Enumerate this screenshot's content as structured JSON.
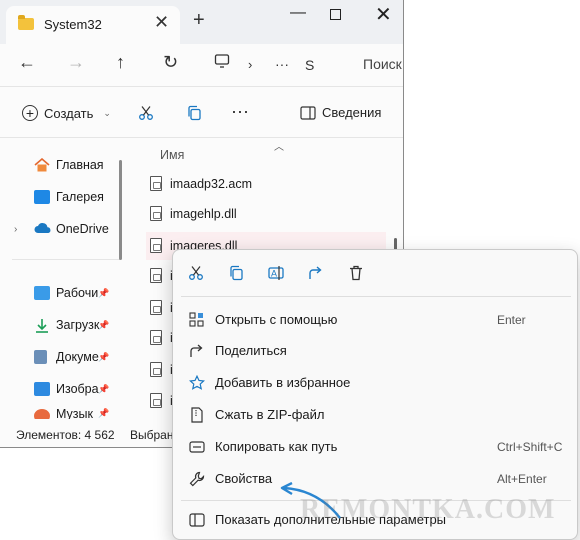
{
  "window": {
    "tab_title": "System32",
    "address_tail": "S",
    "search_text": "Поиск",
    "ellipsis": "···"
  },
  "toolbar": {
    "create_label": "Создать",
    "details_label": "Сведения"
  },
  "sidebar": {
    "items": [
      {
        "label": "Главная",
        "icon": "home-icon"
      },
      {
        "label": "Галерея",
        "icon": "gallery-icon"
      },
      {
        "label": "OneDrive",
        "icon": "onedrive-icon"
      },
      {
        "label": "Рабочи",
        "icon": "desktop-icon"
      },
      {
        "label": "Загрузк",
        "icon": "downloads-icon"
      },
      {
        "label": "Докуме",
        "icon": "documents-icon"
      },
      {
        "label": "Изобра",
        "icon": "pictures-icon"
      },
      {
        "label": "Музык",
        "icon": "music-icon"
      }
    ]
  },
  "files": {
    "column_name": "Имя",
    "rows": [
      {
        "name": "imaadp32.acm"
      },
      {
        "name": "imagehlp.dll"
      },
      {
        "name": "imageres.dll",
        "selected": true
      },
      {
        "name": "i"
      },
      {
        "name": "i"
      },
      {
        "name": "i"
      },
      {
        "name": "i"
      },
      {
        "name": "i"
      }
    ]
  },
  "statusbar": {
    "count": "Элементов: 4 562",
    "selected": "Выбран"
  },
  "context_menu": {
    "items": [
      {
        "label": "Открыть с помощью",
        "shortcut": "Enter",
        "icon": "open-with-icon"
      },
      {
        "label": "Поделиться",
        "shortcut": "",
        "icon": "share-icon"
      },
      {
        "label": "Добавить в избранное",
        "shortcut": "",
        "icon": "star-icon"
      },
      {
        "label": "Сжать в ZIP-файл",
        "shortcut": "",
        "icon": "zip-icon"
      },
      {
        "label": "Копировать как путь",
        "shortcut": "Ctrl+Shift+C",
        "icon": "copy-path-icon"
      },
      {
        "label": "Свойства",
        "shortcut": "Alt+Enter",
        "icon": "wrench-icon"
      },
      {
        "label": "Показать дополнительные параметры",
        "shortcut": "",
        "icon": "more-options-icon"
      }
    ]
  },
  "watermark": "REMONTKA.COM",
  "colors": {
    "accent": "#1a78c2",
    "selection": "#fbeef0",
    "arrow": "#2a86d1"
  }
}
